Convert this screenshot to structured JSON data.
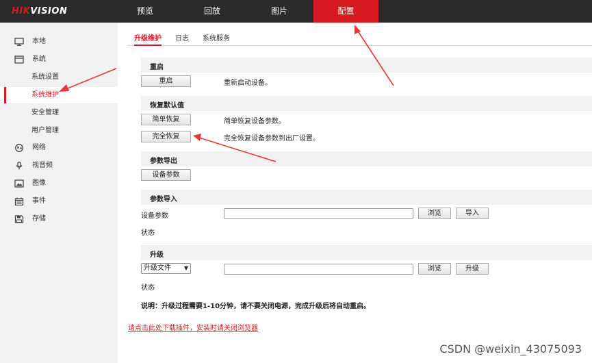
{
  "brand": {
    "prefix": "HIK",
    "suffix": "VISION"
  },
  "nav": [
    {
      "label": "预览"
    },
    {
      "label": "回放"
    },
    {
      "label": "图片"
    },
    {
      "label": "配置"
    }
  ],
  "sidebar": [
    {
      "label": "本地",
      "icon": "monitor-icon"
    },
    {
      "label": "系统",
      "icon": "window-icon"
    },
    {
      "label": "系统设置"
    },
    {
      "label": "系统维护"
    },
    {
      "label": "安全管理"
    },
    {
      "label": "用户管理"
    },
    {
      "label": "网络",
      "icon": "globe-icon"
    },
    {
      "label": "视音频",
      "icon": "microphone-icon"
    },
    {
      "label": "图像",
      "icon": "image-icon"
    },
    {
      "label": "事件",
      "icon": "calendar-icon"
    },
    {
      "label": "存储",
      "icon": "floppy-disk-icon"
    }
  ],
  "tabs": [
    {
      "label": "升级维护"
    },
    {
      "label": "日志"
    },
    {
      "label": "系统服务"
    }
  ],
  "reboot": {
    "title": "重启",
    "button": "重启",
    "desc": "重新启动设备。"
  },
  "restore": {
    "title": "恢复默认值",
    "simple_button": "简单恢复",
    "simple_desc": "简单恢复设备参数。",
    "full_button": "完全恢复",
    "full_desc": "完全恢复设备参数到出厂设置。"
  },
  "export": {
    "title": "参数导出",
    "button": "设备参数"
  },
  "import": {
    "title": "参数导入",
    "label": "设备参数",
    "file_value": "",
    "browse": "浏览",
    "import_button": "导入",
    "status_label": "状态"
  },
  "upgrade": {
    "title": "升级",
    "select_value": "升级文件",
    "file_value": "",
    "browse": "浏览",
    "upgrade_button": "升级",
    "status_label": "状态",
    "note": "说明：升级过程需要1-10分钟，请不要关闭电源，完成升级后将自动重启。"
  },
  "plugin_link": "请点击此处下载插件，安装时请关闭浏览器",
  "watermark": "CSDN @weixin_43075093",
  "colors": {
    "accent": "#d71920",
    "topbar": "#2b2b2b",
    "sidebar": "#f1f1f1",
    "annotation": "#e53935"
  }
}
